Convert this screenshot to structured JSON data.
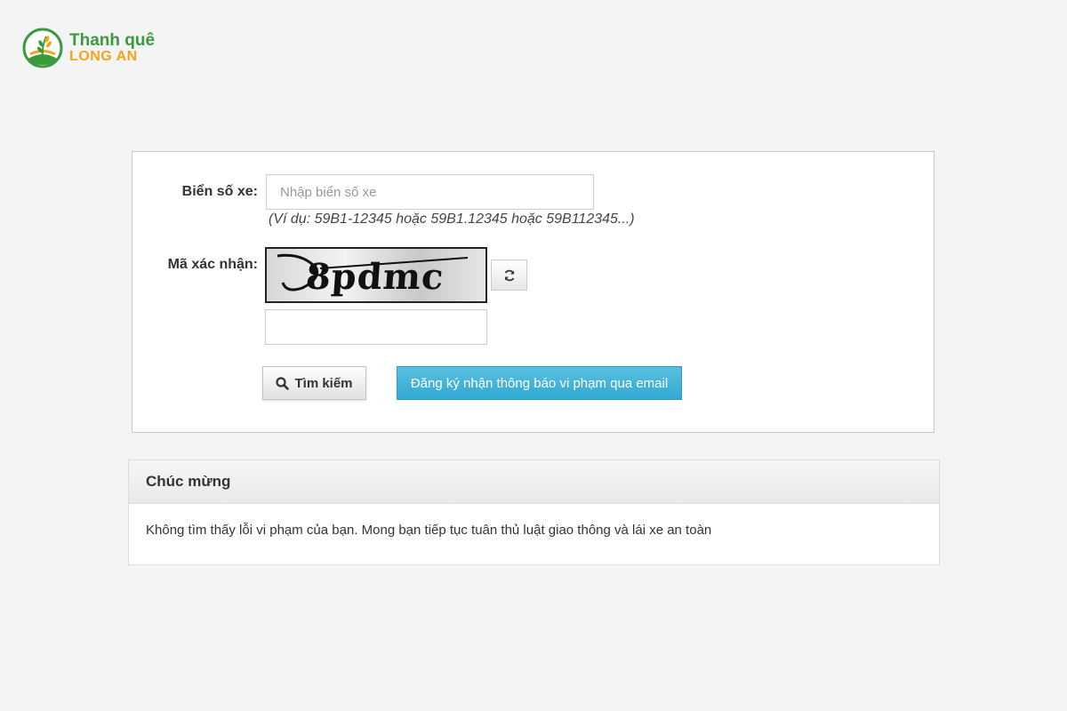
{
  "brand": {
    "line1": "Thanh quê",
    "line2": "LONG AN",
    "icon": "rice-plant-logo-icon",
    "colors": {
      "green": "#3a9a3f",
      "orange": "#f2a51a"
    }
  },
  "search_form": {
    "plate_label": "Biển số xe:",
    "plate_placeholder": "Nhập biển số xe",
    "plate_value": "",
    "plate_hint": "(Ví dụ: 59B1-12345 hoặc 59B1.12345 hoặc 59B112345...)",
    "captcha_label": "Mã xác nhận:",
    "captcha_text": "8pdmc",
    "captcha_value": "",
    "refresh_icon": "refresh-icon",
    "search_button_label": "Tìm kiếm",
    "search_icon": "search-icon",
    "email_button_label": "Đăng ký nhận thông báo vi phạm qua email",
    "email_button_color": "#31a8d3"
  },
  "result": {
    "title": "Chúc mừng",
    "message": "Không tìm thấy lỗi vi phạm của bạn. Mong bạn tiếp tục tuân thủ luật giao thông và lái xe an toàn"
  }
}
